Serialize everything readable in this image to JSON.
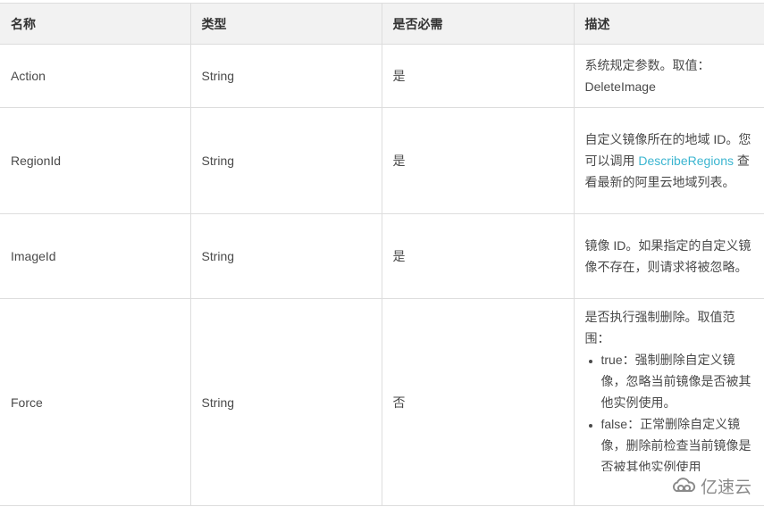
{
  "table": {
    "headers": [
      "名称",
      "类型",
      "是否必需",
      "描述"
    ],
    "rows": [
      {
        "name": "Action",
        "type": "String",
        "required": "是",
        "description": {
          "text": "系统规定参数。取值：DeleteImage"
        }
      },
      {
        "name": "RegionId",
        "type": "String",
        "required": "是",
        "description": {
          "before": "自定义镜像所在的地域 ID。您可以调用 ",
          "link": "DescribeRegions",
          "after": " 查看最新的阿里云地域列表。"
        }
      },
      {
        "name": "ImageId",
        "type": "String",
        "required": "是",
        "description": {
          "text": "镜像 ID。如果指定的自定义镜像不存在，则请求将被忽略。"
        }
      },
      {
        "name": "Force",
        "type": "String",
        "required": "否",
        "description": {
          "text": "是否执行强制删除。取值范围：",
          "options": [
            "true：强制删除自定义镜像，忽略当前镜像是否被其他实例使用。",
            "false：正常删除自定义镜像，删除前检查当前镜像是否被其他实例使用"
          ]
        }
      }
    ]
  },
  "watermark": {
    "icon": "cloud-logo-icon",
    "text": "亿速云"
  },
  "colors": {
    "link": "#3bb5d0",
    "header_bg": "#f2f2f2",
    "border": "#dddddd",
    "text": "#4a4a4a"
  }
}
